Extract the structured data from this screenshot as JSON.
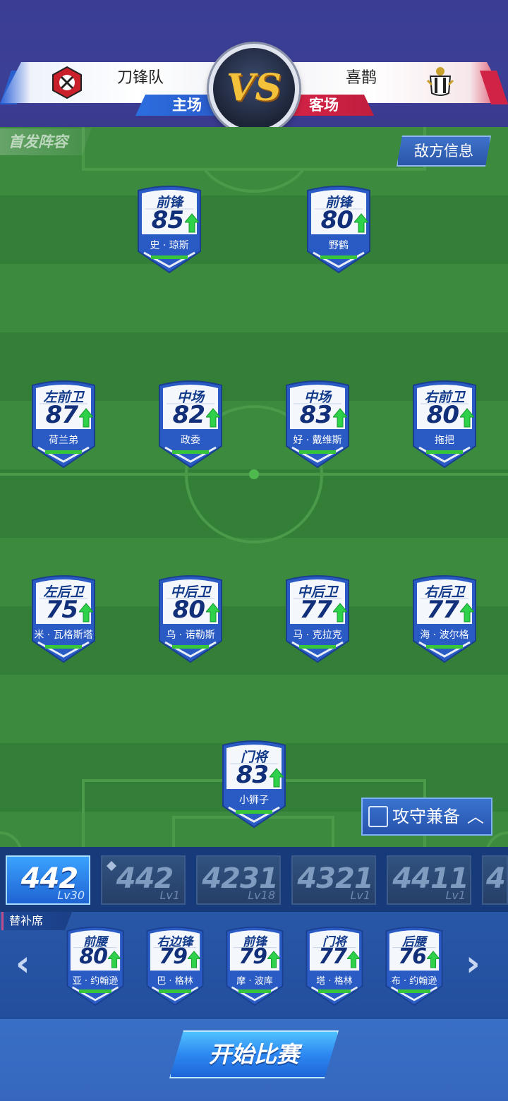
{
  "match": {
    "home_team": "刀锋队",
    "away_team": "喜鹊",
    "home_label": "主场",
    "away_label": "客场",
    "vs": "VS"
  },
  "pitch": {
    "lineup_label": "首发阵容",
    "enemy_info_label": "敌方信息",
    "tactics_label": "攻守兼备"
  },
  "starters": [
    {
      "position": "前锋",
      "rating": "85",
      "name": "史 · 琼斯"
    },
    {
      "position": "前锋",
      "rating": "80",
      "name": "野鹤"
    },
    {
      "position": "左前卫",
      "rating": "87",
      "name": "荷兰弟"
    },
    {
      "position": "中场",
      "rating": "82",
      "name": "政委"
    },
    {
      "position": "中场",
      "rating": "83",
      "name": "好 · 戴维斯"
    },
    {
      "position": "右前卫",
      "rating": "80",
      "name": "拖把"
    },
    {
      "position": "左后卫",
      "rating": "75",
      "name": "米 · 瓦格斯塔"
    },
    {
      "position": "中后卫",
      "rating": "80",
      "name": "乌 · 诺勒斯"
    },
    {
      "position": "中后卫",
      "rating": "77",
      "name": "马 · 克拉克"
    },
    {
      "position": "右后卫",
      "rating": "77",
      "name": "海 · 波尔格"
    },
    {
      "position": "门将",
      "rating": "83",
      "name": "小狮子"
    }
  ],
  "formations": [
    {
      "name": "442",
      "level": "Lv30"
    },
    {
      "name": "442",
      "level": "Lv1"
    },
    {
      "name": "4231",
      "level": "Lv18"
    },
    {
      "name": "4321",
      "level": "Lv1"
    },
    {
      "name": "4411",
      "level": "Lv1"
    },
    {
      "name": "4",
      "level": ""
    }
  ],
  "bench": {
    "label": "替补席",
    "players": [
      {
        "position": "前腰",
        "rating": "80",
        "name": "亚 · 约翰逊"
      },
      {
        "position": "右边锋",
        "rating": "79",
        "name": "巴 · 格林"
      },
      {
        "position": "前锋",
        "rating": "79",
        "name": "摩 · 波库"
      },
      {
        "position": "门将",
        "rating": "77",
        "name": "塔 · 格林"
      },
      {
        "position": "后腰",
        "rating": "76",
        "name": "布 · 约翰逊"
      }
    ]
  },
  "start_button": "开始比赛",
  "icons": {
    "nav_left": "chevron-left-icon",
    "nav_right": "chevron-right-icon",
    "up_chevron": "chevron-up-icon",
    "rating_up": "green-up-arrow-icon"
  },
  "colors": {
    "pitch": "#3b8a3e",
    "card_blue": "#2a5bc4",
    "accent_green": "#37c63a",
    "home_blue": "#2c6ee0",
    "away_red": "#d52346"
  }
}
